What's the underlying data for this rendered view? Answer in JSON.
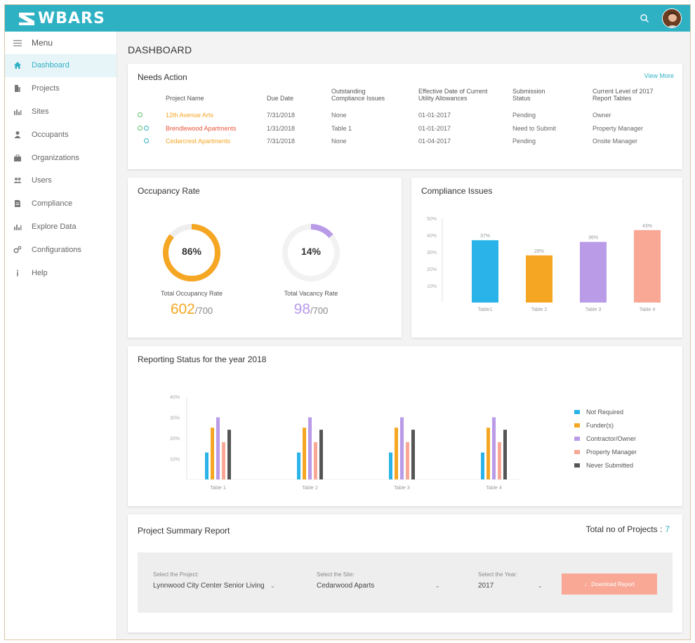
{
  "app": {
    "logo": "WBARS"
  },
  "colors": {
    "accent": "#2fb1c4",
    "orange": "#f5a623",
    "purple": "#b99be8",
    "blue": "#2ab3e8",
    "salmon": "#f8a895",
    "dark": "#555555"
  },
  "sidebar": {
    "menu_label": "Menu",
    "items": [
      {
        "label": "Dashboard",
        "icon": "home-icon"
      },
      {
        "label": "Projects",
        "icon": "building-icon"
      },
      {
        "label": "Sites",
        "icon": "city-icon"
      },
      {
        "label": "Occupants",
        "icon": "person-icon"
      },
      {
        "label": "Organizations",
        "icon": "briefcase-icon"
      },
      {
        "label": "Users",
        "icon": "users-icon"
      },
      {
        "label": "Compliance",
        "icon": "document-icon"
      },
      {
        "label": "Explore Data",
        "icon": "chart-icon"
      },
      {
        "label": "Configurations",
        "icon": "gears-icon"
      },
      {
        "label": "Help",
        "icon": "info-icon"
      }
    ]
  },
  "page_title": "DASHBOARD",
  "needs_action": {
    "title": "Needs Action",
    "view_more": "View More",
    "headers": {
      "project": "Project Name",
      "due": "Due Date",
      "issues_1": "Outstanding",
      "issues_2": "Compliance Issues",
      "eff_1": "Effective Date of Current",
      "eff_2": "Utility Allowances",
      "status_1": "Submission",
      "status_2": "Status",
      "level_1": "Current Level of 2017",
      "level_2": "Report Tables"
    },
    "rows": [
      {
        "name": "12th Avenue Arts",
        "due": "7/31/2018",
        "issues": "None",
        "effective": "01-01-2017",
        "status": "Pending",
        "level": "Owner"
      },
      {
        "name": "Brendlewood Apartments",
        "due": "1/31/2018",
        "issues": "Table 1",
        "effective": "01-01-2017",
        "status": "Need to Submit",
        "level": "Property Manager"
      },
      {
        "name": "Cedarcrest Apartments",
        "due": "7/31/2018",
        "issues": "None",
        "effective": "01-04-2017",
        "status": "Pending",
        "level": "Onsite Manager"
      }
    ]
  },
  "occupancy": {
    "title": "Occupancy Rate",
    "occupancy_pct": "86%",
    "occupancy_value": 86,
    "occupancy_label": "Total Occupancy Rate",
    "occupied": "602",
    "total_occ": "/700",
    "vacancy_pct": "14%",
    "vacancy_value": 14,
    "vacancy_label": "Total Vacancy Rate",
    "vacant": "98",
    "total_vac": "/700"
  },
  "compliance": {
    "title": "Compliance Issues",
    "chart_data": {
      "type": "bar",
      "categories": [
        "Table1",
        "Table 2",
        "Table 3",
        "Table 4"
      ],
      "values": [
        37,
        28,
        36,
        43
      ],
      "data_labels": [
        "37%",
        "28%",
        "36%",
        "43%"
      ],
      "colors": [
        "#2ab3e8",
        "#f5a623",
        "#b99be8",
        "#f8a895"
      ],
      "yticks": [
        "10%",
        "20%",
        "30%",
        "40%",
        "50%"
      ],
      "ylim": [
        0,
        50
      ]
    }
  },
  "reporting": {
    "title": "Reporting Status for the year 2018",
    "chart_data": {
      "type": "bar",
      "categories": [
        "Table 1",
        "Table 2",
        "Table 3",
        "Table 4"
      ],
      "yticks": [
        "10%",
        "20%",
        "30%",
        "40%"
      ],
      "ylim": [
        0,
        40
      ],
      "series": [
        {
          "name": "Not Required",
          "color": "#2ab3e8",
          "values": [
            13,
            13,
            13,
            13
          ]
        },
        {
          "name": "Funder(s)",
          "color": "#f5a623",
          "values": [
            25,
            25,
            25,
            25
          ]
        },
        {
          "name": "Contractor/Owner",
          "color": "#b99be8",
          "values": [
            30,
            30,
            30,
            30
          ]
        },
        {
          "name": "Property Manager",
          "color": "#f8a895",
          "values": [
            18,
            18,
            18,
            18
          ]
        },
        {
          "name": "Never Submitted",
          "color": "#555555",
          "values": [
            24,
            24,
            24,
            24
          ]
        }
      ]
    }
  },
  "summary": {
    "title": "Project Summary Report",
    "total_label": "Total no of Projects :",
    "total_count": "7",
    "project_label": "Select the Project:",
    "project_value": "Lynnwood City Center Senior Living",
    "site_label": "Select the Site:",
    "site_value": "Cedarwood Aparts",
    "year_label": "Select the Year:",
    "year_value": "2017",
    "download_label": "Download Report"
  }
}
